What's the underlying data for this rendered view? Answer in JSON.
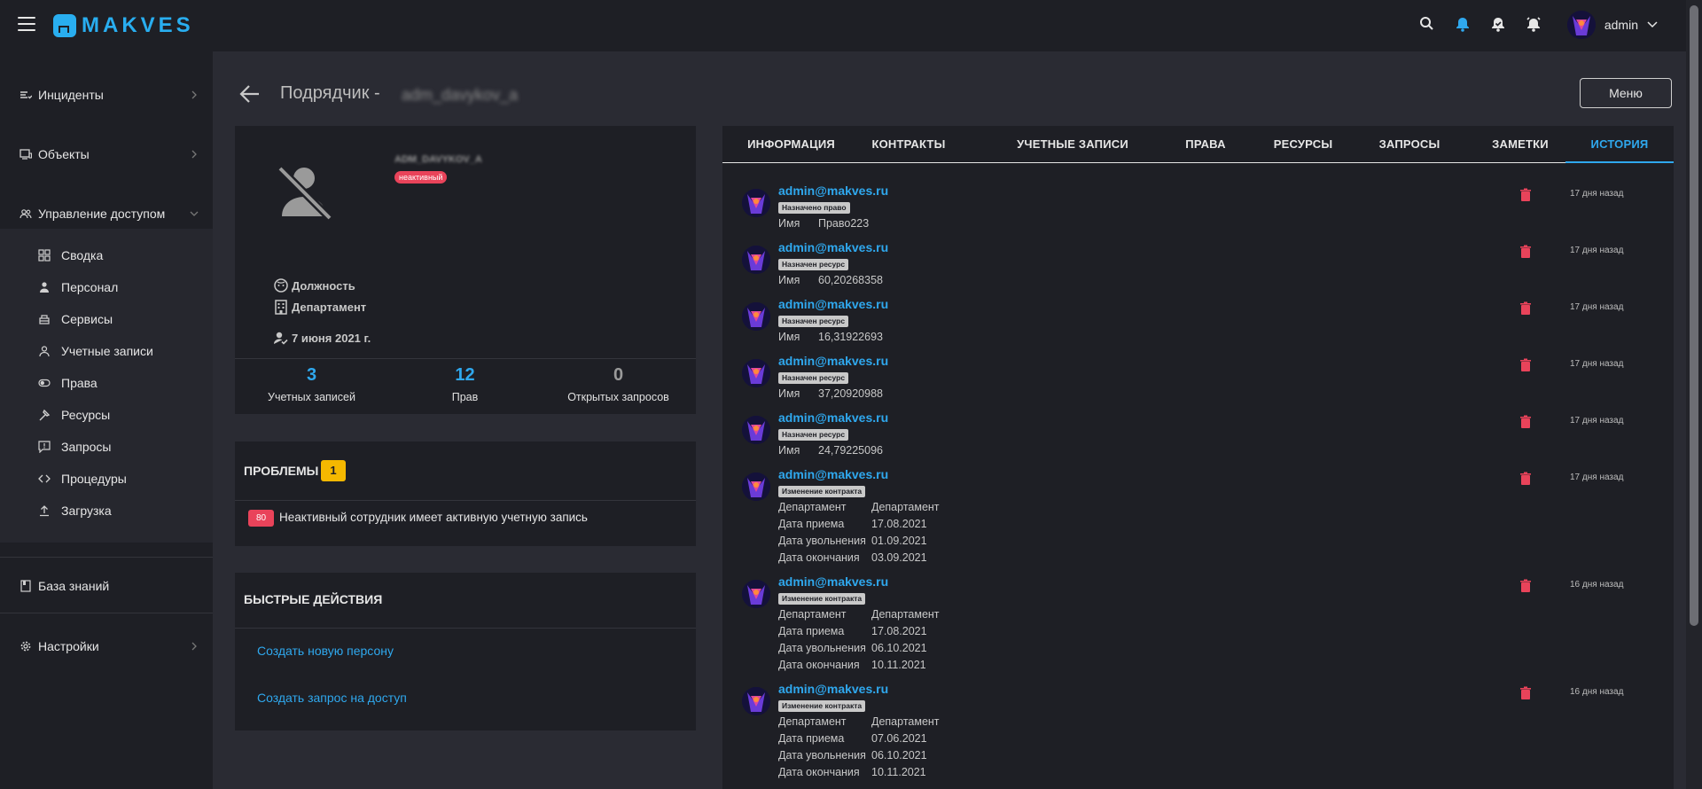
{
  "app": {
    "logo_text": "MAKVES",
    "accent": "#29aef0"
  },
  "topbar": {
    "user": "admin",
    "icons": [
      "search-icon",
      "bell-icon",
      "bell-check-icon",
      "alarm-icon"
    ]
  },
  "sidebar": {
    "incidents": "Инциденты",
    "objects": "Объекты",
    "access": "Управление доступом",
    "sub": [
      "Сводка",
      "Персонал",
      "Сервисы",
      "Учетные записи",
      "Права",
      "Ресурсы",
      "Запросы",
      "Процедуры",
      "Загрузка"
    ],
    "knowledge": "База знаний",
    "settings": "Настройки"
  },
  "header": {
    "title": "Подрядчик -",
    "name": "adm_davykov_a",
    "menu": "Меню"
  },
  "profile": {
    "login": "ADM_DAVYKOV_A",
    "status": "неактивный",
    "position": "Должность",
    "department": "Департамент",
    "date": "7 июня 2021 г.",
    "stats": [
      {
        "value": "3",
        "label": "Учетных записей"
      },
      {
        "value": "12",
        "label": "Прав"
      },
      {
        "value": "0",
        "label": "Открытых запросов"
      }
    ]
  },
  "problems": {
    "title": "ПРОБЛЕМЫ",
    "count": "1",
    "severity": "80",
    "text": "Неактивный сотрудник имеет активную учетную запись"
  },
  "actions": {
    "title": "БЫСТРЫЕ ДЕЙСТВИЯ",
    "create_person": "Создать новую персону",
    "create_request": "Создать запрос на доступ"
  },
  "tabs": [
    "ИНФОРМАЦИЯ",
    "КОНТРАКТЫ",
    "УЧЕТНЫЕ ЗАПИСИ",
    "ПРАВА",
    "РЕСУРСЫ",
    "ЗАПРОСЫ",
    "ЗАМЕТКИ",
    "ИСТОРИЯ"
  ],
  "active_tab": "ИСТОРИЯ",
  "history": [
    {
      "author": "admin@makves.ru",
      "type": "Назначено право",
      "time": "17 дня назад",
      "fields": [
        [
          "Имя",
          "Право223"
        ]
      ]
    },
    {
      "author": "admin@makves.ru",
      "type": "Назначен ресурс",
      "time": "17 дня назад",
      "fields": [
        [
          "Имя",
          "60,20268358"
        ]
      ]
    },
    {
      "author": "admin@makves.ru",
      "type": "Назначен ресурс",
      "time": "17 дня назад",
      "fields": [
        [
          "Имя",
          "16,31922693"
        ]
      ]
    },
    {
      "author": "admin@makves.ru",
      "type": "Назначен ресурс",
      "time": "17 дня назад",
      "fields": [
        [
          "Имя",
          "37,20920988"
        ]
      ]
    },
    {
      "author": "admin@makves.ru",
      "type": "Назначен ресурс",
      "time": "17 дня назад",
      "fields": [
        [
          "Имя",
          "24,79225096"
        ]
      ]
    },
    {
      "author": "admin@makves.ru",
      "type": "Изменение контракта",
      "time": "17 дня назад",
      "fields": [
        [
          "Департамент",
          "Департамент"
        ],
        [
          "Дата приема",
          "17.08.2021"
        ],
        [
          "Дата увольнения",
          "01.09.2021"
        ],
        [
          "Дата окончания",
          "03.09.2021"
        ]
      ]
    },
    {
      "author": "admin@makves.ru",
      "type": "Изменение контракта",
      "time": "16 дня назад",
      "fields": [
        [
          "Департамент",
          "Департамент"
        ],
        [
          "Дата приема",
          "17.08.2021"
        ],
        [
          "Дата увольнения",
          "06.10.2021"
        ],
        [
          "Дата окончания",
          "10.11.2021"
        ]
      ]
    },
    {
      "author": "admin@makves.ru",
      "type": "Изменение контракта",
      "time": "16 дня назад",
      "fields": [
        [
          "Департамент",
          "Департамент"
        ],
        [
          "Дата приема",
          "07.06.2021"
        ],
        [
          "Дата увольнения",
          "06.10.2021"
        ],
        [
          "Дата окончания",
          "10.11.2021"
        ]
      ]
    }
  ]
}
